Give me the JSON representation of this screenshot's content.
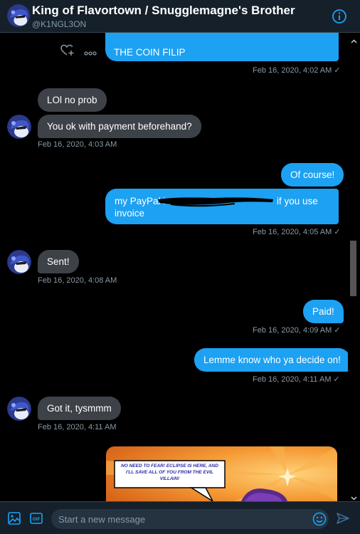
{
  "header": {
    "title": "King of Flavortown / Snugglemagne's Brother",
    "handle": "@K1NGL3ON"
  },
  "messages": {
    "coin_flip": {
      "text": "THE COIN FILIP",
      "ts": "Feb 16, 2020, 4:02 AM ✓"
    },
    "lol": {
      "text": "LOl no prob"
    },
    "payment_q": {
      "text": "You ok with payment beforehand?",
      "ts": "Feb 16, 2020, 4:03 AM"
    },
    "of_course": {
      "text": "Of course!"
    },
    "paypal": {
      "line1_a": "my PayPal i",
      "line1_b": "if you use",
      "line2": "invoice",
      "ts": "Feb 16, 2020, 4:05 AM ✓"
    },
    "sent": {
      "text": "Sent!",
      "ts": "Feb 16, 2020, 4:08 AM"
    },
    "paid": {
      "text": "Paid!",
      "ts": "Feb 16, 2020, 4:09 AM ✓"
    },
    "lemme": {
      "text": "Lemme know who ya decide on!",
      "ts": "Feb 16, 2020, 4:11 AM ✓"
    },
    "gotit": {
      "text": "Got it, tysmmm",
      "ts": "Feb 16, 2020, 4:11 AM"
    }
  },
  "comic": {
    "speech": "NO NEED TO FEAR! ECLIPSE IS HERE, AND I'LL SAVE ALL OF YOU FROM THE EVIL VILLAIN!"
  },
  "composer": {
    "placeholder": "Start a new message"
  },
  "icons": [
    "heart-plus-icon",
    "more-icon",
    "info-icon",
    "image-icon",
    "gif-icon",
    "emoji-icon",
    "send-icon"
  ],
  "colors": {
    "header_bg": "#15202b",
    "outgoing": "#1da1f2",
    "incoming": "#3d4148",
    "muted": "#8899a6"
  }
}
